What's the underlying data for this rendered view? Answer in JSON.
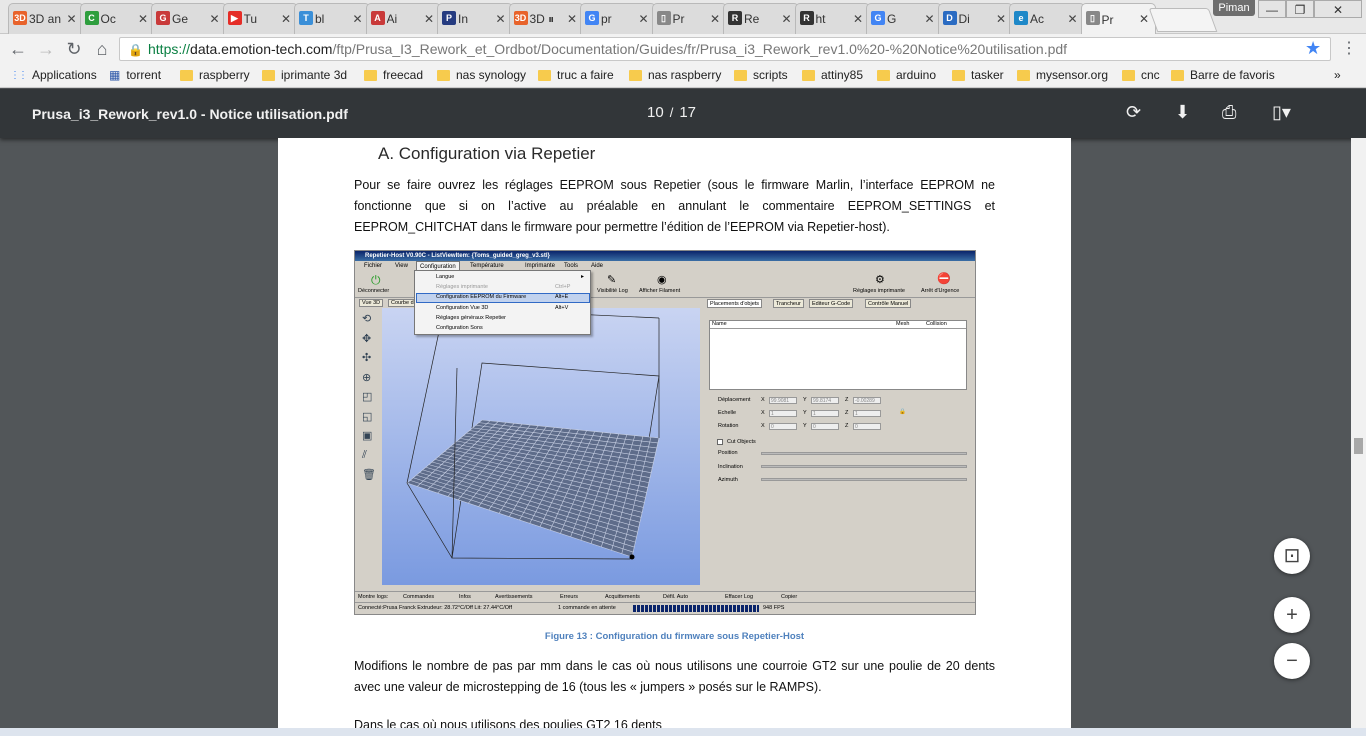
{
  "tabs": [
    {
      "title": "3D an",
      "fav": "3D",
      "color": "#e8632b"
    },
    {
      "title": "Oc",
      "fav": "C",
      "color": "#2e9e3e"
    },
    {
      "title": "Ge",
      "fav": "G",
      "color": "#c93a3a"
    },
    {
      "title": "Tu",
      "fav": "▶",
      "color": "#e52d27"
    },
    {
      "title": "bl",
      "fav": "T",
      "color": "#3a8fd8"
    },
    {
      "title": "Ai",
      "fav": "A",
      "color": "#c93a3a"
    },
    {
      "title": "In",
      "fav": "P",
      "color": "#253b80"
    },
    {
      "title": "3D ⏸",
      "fav": "3D",
      "color": "#e8632b"
    },
    {
      "title": "pr",
      "fav": "G",
      "color": "#4285f4"
    },
    {
      "title": "Pr",
      "fav": "▯",
      "color": "#888888"
    },
    {
      "title": "Re",
      "fav": "R",
      "color": "#333333"
    },
    {
      "title": "ht",
      "fav": "R",
      "color": "#333333"
    },
    {
      "title": "G",
      "fav": "G",
      "color": "#4285f4"
    },
    {
      "title": "Di",
      "fav": "D",
      "color": "#2a6bc2"
    },
    {
      "title": "Ac",
      "fav": "e",
      "color": "#1e88c8"
    },
    {
      "title": "Pr",
      "fav": "▯",
      "color": "#888888"
    }
  ],
  "profile": "Piman",
  "window_controls": {
    "minimize": "—",
    "restore": "❐",
    "close": "✕"
  },
  "address": {
    "scheme": "https://",
    "host": "data.emotion-tech.com",
    "path": "/ftp/Prusa_I3_Rework_et_Ordbot/Documentation/Guides/fr/Prusa_i3_Rework_rev1.0%20-%20Notice%20utilisation.pdf"
  },
  "bookmarks": [
    {
      "label": "Applications",
      "kind": "apps"
    },
    {
      "label": "torrent",
      "kind": "site"
    },
    {
      "label": "raspberry",
      "kind": "folder"
    },
    {
      "label": "iprimante 3d",
      "kind": "folder"
    },
    {
      "label": "freecad",
      "kind": "folder"
    },
    {
      "label": "nas synology",
      "kind": "folder"
    },
    {
      "label": "truc a faire",
      "kind": "folder"
    },
    {
      "label": "nas raspberry",
      "kind": "folder"
    },
    {
      "label": "scripts",
      "kind": "folder"
    },
    {
      "label": "attiny85",
      "kind": "folder"
    },
    {
      "label": "arduino",
      "kind": "folder"
    },
    {
      "label": "tasker",
      "kind": "folder"
    },
    {
      "label": "mysensor.org",
      "kind": "folder"
    },
    {
      "label": "cnc",
      "kind": "folder"
    },
    {
      "label": "Barre de favoris",
      "kind": "folder"
    }
  ],
  "bookmarks_more": "»",
  "pdf": {
    "title": "Prusa_i3_Rework_rev1.0 - Notice utilisation.pdf",
    "current_page": "10",
    "separator": "/",
    "total_pages": "17"
  },
  "document": {
    "heading": "A. Configuration via Repetier",
    "para1": "Pour se faire ouvrez les réglages EEPROM sous Repetier (sous le firmware Marlin, l’interface EEPROM ne fonctionne que si on l’active au préalable en annulant le commentaire EEPROM_SETTINGS et EEPROM_CHITCHAT dans le firmware pour permettre l’édition de l’EEPROM via Repetier-host).",
    "caption": "Figure 13 : Configuration du firmware sous Repetier-Host",
    "para2": "Modifions le nombre de pas par mm dans le cas où nous utilisons une courroie GT2 sur une poulie de 20 dents avec une valeur de microstepping de 16 (tous les « jumpers » posés sur le RAMPS).",
    "para3": "Dans le cas où nous utilisons des poulies GT2 16 dents"
  },
  "repetier": {
    "title": "Repetier-Host V0.90C - ListViewItem: {Toms_guided_greg_v3.stl}",
    "menu": [
      "Fichier",
      "View",
      "Configuration",
      "Température",
      "Imprimante",
      "Tools",
      "Aide"
    ],
    "toolbar": [
      "Déconnecter",
      "Visibilité Log",
      "Afficher Filament",
      "Réglages imprimante",
      "Arrêt d'Urgence"
    ],
    "dropdown": [
      {
        "label": "Langue",
        "key": ""
      },
      {
        "label": "Réglages imprimante",
        "key": "Ctrl+P"
      },
      {
        "label": "Configuration EEPROM du Firmware",
        "key": "Alt+E"
      },
      {
        "label": "Configuration Vue 3D",
        "key": "Alt+V"
      },
      {
        "label": "Réglages généraux Repetier",
        "key": ""
      },
      {
        "label": "Configuration Sons",
        "key": ""
      }
    ],
    "view_tabs": [
      "Vue 3D",
      "Courbe d"
    ],
    "right_tabs": [
      "Placements d'objets",
      "Trancheur",
      "Editeur G-Code",
      "Contrôle Manuel"
    ],
    "list_headers": [
      "Name",
      "Mesh",
      "Collision"
    ],
    "transform": {
      "deplacement": "Déplacement",
      "echelle": "Echelle",
      "rotation": "Rotation",
      "dx": "99.9081",
      "dy": "99.8174",
      "dz": "-0.00289",
      "s": "1",
      "r": "0",
      "x": "X",
      "y": "Y",
      "z": "Z"
    },
    "cut": {
      "label": "Cut Objects",
      "position": "Position",
      "inclination": "Inclination",
      "azimuth": "Azimuth"
    },
    "log_bar": [
      "Montre logs:",
      "Commandes",
      "Infos",
      "Avertissements",
      "Erreurs",
      "Acquittements",
      "Défil. Auto",
      "Effacer Log",
      "Copier"
    ],
    "status": {
      "connection": "Connecté:Prusa Franck  Extrudeur: 28.72°C/Off Lit: 27.44°C/Off",
      "queue": "1 commande en attente",
      "fps": "948 FPS"
    }
  },
  "zoom": {
    "fit": "⊡",
    "in": "+",
    "out": "−"
  }
}
